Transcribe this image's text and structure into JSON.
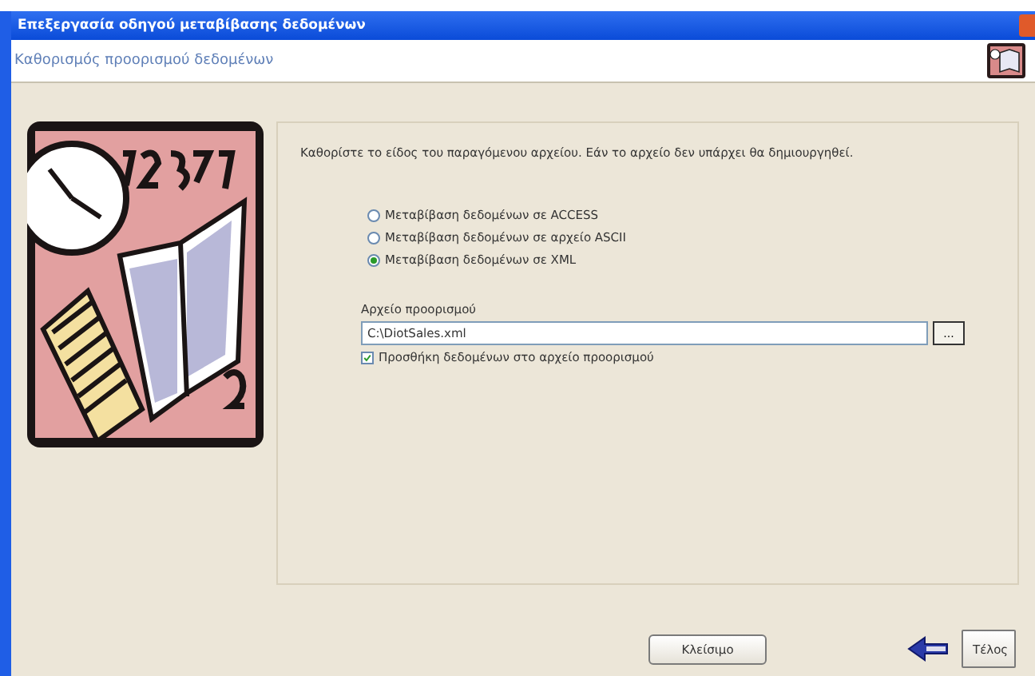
{
  "window": {
    "title": "Επεξεργασία οδηγού μεταβίβασης δεδομένων"
  },
  "header": {
    "title": "Καθορισμός προορισμού δεδομένων"
  },
  "instruction": "Καθορίστε το είδος του παραγόμενου αρχείου. Εάν το αρχείο δεν υπάρχει θα δημιουργηθεί.",
  "options": [
    {
      "label": "Μεταβίβαση δεδομένων σε ACCESS",
      "selected": false
    },
    {
      "label": "Μεταβίβαση δεδομένων σε αρχείο ASCII",
      "selected": false
    },
    {
      "label": "Μεταβίβαση δεδομένων σε XML",
      "selected": true
    }
  ],
  "destination": {
    "label": "Αρχείο προορισμού",
    "value": "C:\\DiotSales.xml",
    "browse": "..."
  },
  "append": {
    "label": "Προσθήκη δεδομένων στο αρχείο προορισμού",
    "checked": true
  },
  "buttons": {
    "close": "Κλείσιμο",
    "finish": "Τέλος"
  }
}
